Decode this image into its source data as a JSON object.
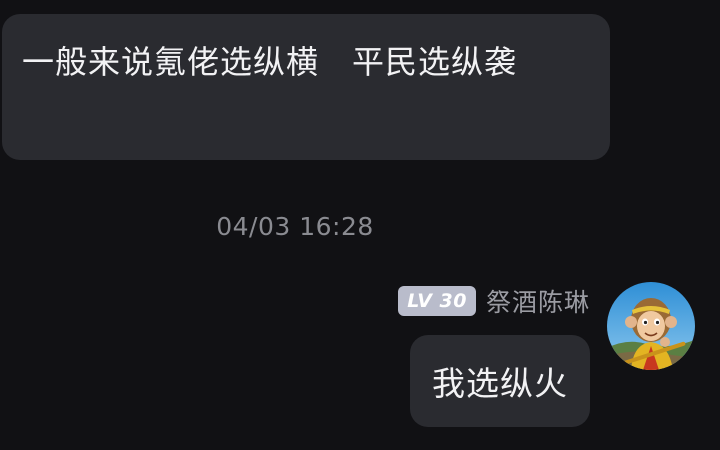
{
  "messages": {
    "incoming": {
      "text": "一般来说氪佬选纵横　平民选纵袭"
    },
    "timestamp": "04/03 16:28",
    "outgoing": {
      "level": "LV 30",
      "sender": "祭酒陈琳",
      "text": "我选纵火",
      "avatar_icon": "monkey-king-avatar"
    }
  },
  "colors": {
    "background": "#111114",
    "bubble": "#2a2b30",
    "badge": "#b9bccb",
    "muted_text": "#8a8b91"
  }
}
